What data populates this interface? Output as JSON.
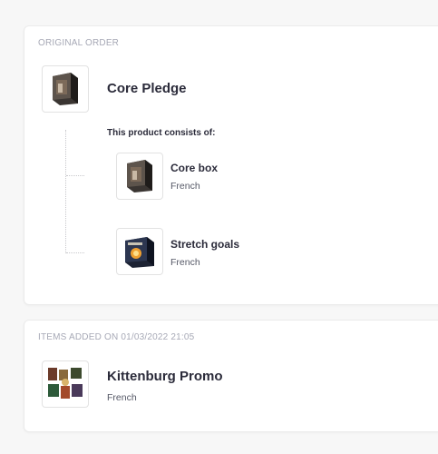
{
  "original_order": {
    "section_label": "ORIGINAL ORDER",
    "product": {
      "title": "Core Pledge",
      "image": "core-box-thumbnail"
    },
    "consists_label": "This product consists of:",
    "components": [
      {
        "title": "Core box",
        "language": "French",
        "image": "core-box-thumbnail"
      },
      {
        "title": "Stretch goals",
        "language": "French",
        "image": "stretch-goals-thumbnail"
      }
    ]
  },
  "added_items": {
    "section_label": "ITEMS ADDED ON 01/03/2022 21:05",
    "product": {
      "title": "Kittenburg Promo",
      "language": "French",
      "image": "kittenburg-promo-thumbnail"
    }
  }
}
